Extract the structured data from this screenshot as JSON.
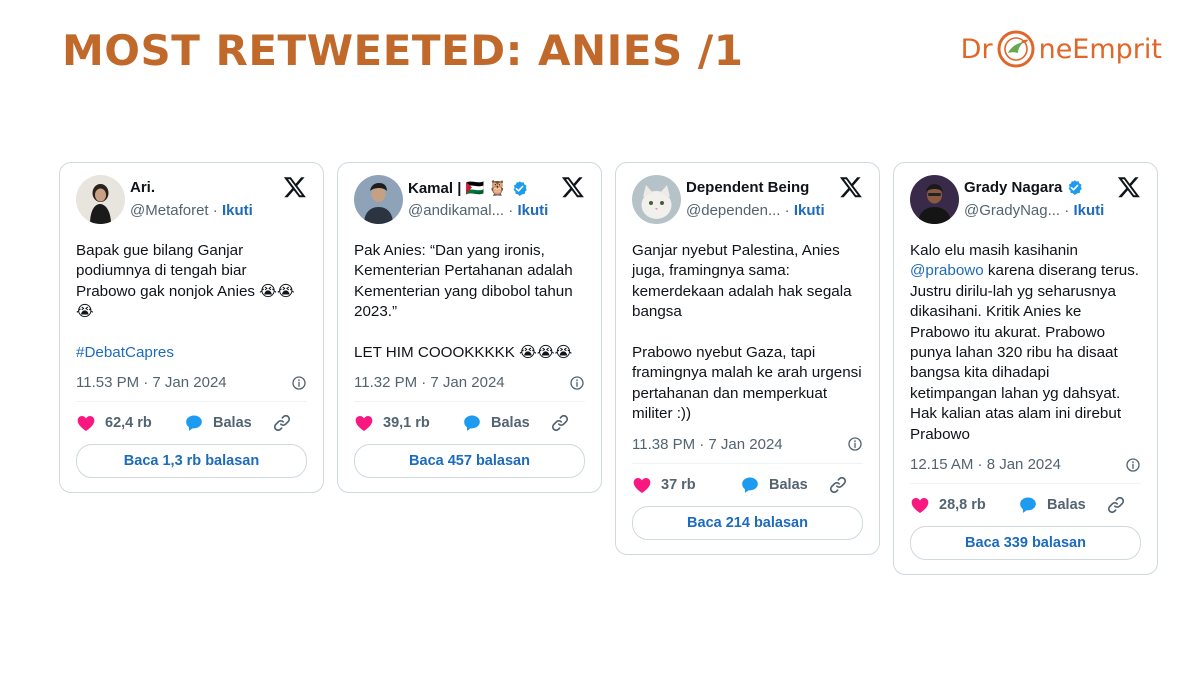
{
  "slide": {
    "title": "MOST RETWEETED: ANIES /1"
  },
  "logo": {
    "text_left": "Dr",
    "text_right": "neEmprit"
  },
  "colors": {
    "title": "#c0692b",
    "link": "#1d6bbd",
    "heart": "#f91880",
    "reply": "#1d9bf0",
    "verified": "#1d9bf0"
  },
  "tweets": [
    {
      "name": "Ari.",
      "handle": "@Metaforet",
      "follow": "Ikuti",
      "text": "Bapak gue bilang Ganjar\npodiumnya di tengah biar\nPrabowo gak nonjok Anies 😭😭\n😭",
      "hashtag": "#DebatCapres",
      "time": "11.53 PM · 7 Jan 2024",
      "likes": "62,4 rb",
      "reply_label": "Balas",
      "read_replies": "Baca 1,3 rb balasan"
    },
    {
      "name": "Kamal | 🇵🇸 🦉",
      "handle": "@andikamal...",
      "follow": "Ikuti",
      "text": "Pak Anies: “Dan yang ironis,\nKementerian Pertahanan adalah\nKementerian yang dibobol tahun\n2023.”\n\nLET HIM COOOKKKKK 😭😭😭",
      "time": "11.32 PM · 7 Jan 2024",
      "likes": "39,1 rb",
      "reply_label": "Balas",
      "read_replies": "Baca 457 balasan"
    },
    {
      "name": "Dependent Being",
      "handle": "@dependen...",
      "follow": "Ikuti",
      "text": "Ganjar nyebut Palestina, Anies\njuga, framingnya sama:\nkemerdekaan adalah hak segala\nbangsa\n\nPrabowo nyebut Gaza, tapi\nframingnya malah ke arah urgensi\npertahanan dan memperkuat\nmiliter :))",
      "time": "11.38 PM · 7 Jan 2024",
      "likes": "37 rb",
      "reply_label": "Balas",
      "read_replies": "Baca 214 balasan"
    },
    {
      "name": "Grady Nagara",
      "handle": "@GradyNag...",
      "follow": "Ikuti",
      "mention": "@prabowo",
      "text_before": "Kalo elu masih kasihanin\n",
      "text_after": " karena diserang terus.\nJustru dirilu-lah yg seharusnya\ndikasihani. Kritik Anies ke\nPrabowo itu akurat. Prabowo\npunya lahan 320 ribu ha disaat\nbangsa kita dihadapi\nketimpangan lahan yg dahsyat.\nHak kalian atas alam ini direbut\nPrabowo",
      "time": "12.15 AM · 8 Jan 2024",
      "likes": "28,8 rb",
      "reply_label": "Balas",
      "read_replies": "Baca 339 balasan"
    }
  ]
}
